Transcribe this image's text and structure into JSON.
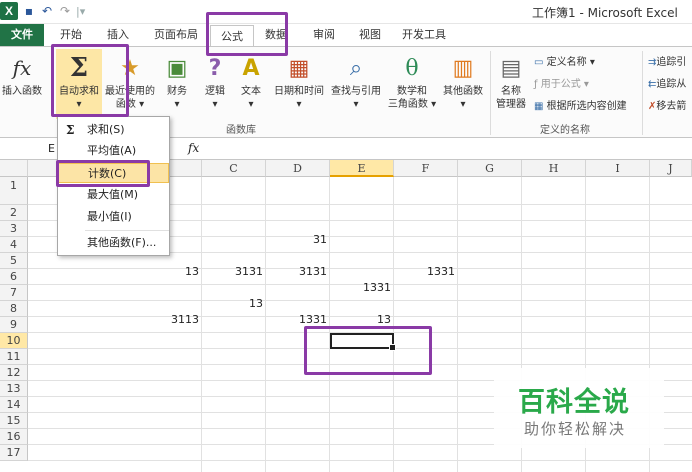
{
  "window": {
    "title": "工作簿1 - Microsoft Excel"
  },
  "tabs": [
    "文件",
    "开始",
    "插入",
    "页面布局",
    "公式",
    "数据",
    "审阅",
    "视图",
    "开发工具"
  ],
  "ribbon": {
    "insert_function": "插入函数",
    "autosum_line1": "自动求和",
    "autosum_arrow": "▾",
    "recent_line1": "最近使用的",
    "recent_line2": "函数 ▾",
    "financial": "财务",
    "logical": "逻辑",
    "text": "文本",
    "datetime": "日期和时间",
    "lookup": "查找与引用",
    "math_line1": "数学和",
    "math_line2": "三角函数 ▾",
    "other_funcs": "其他函数",
    "name_manager_line1": "名称",
    "name_manager_line2": "管理器",
    "define_name": "定义名称 ▾",
    "use_in_formula": "用于公式 ▾",
    "create_from_selection": "根据所选内容创建",
    "trace_precedents": "追踪引",
    "trace_dependents": "追踪从",
    "remove_arrows": "移去箭",
    "group_library": "函数库",
    "group_names": "定义的名称"
  },
  "formula_bar": {
    "name_box": "E",
    "fx": "fx",
    "value": ""
  },
  "menu": {
    "items": [
      {
        "label": "求和(S)"
      },
      {
        "label": "平均值(A)"
      },
      {
        "label": "计数(C)"
      },
      {
        "label": "最大值(M)"
      },
      {
        "label": "最小值(I)"
      },
      {
        "label": "其他函数(F)..."
      }
    ]
  },
  "grid": {
    "columns": [
      "C",
      "D",
      "E",
      "F",
      "G",
      "H",
      "I",
      "J"
    ],
    "rows": [
      "1",
      "2",
      "3",
      "4",
      "5",
      "6",
      "7",
      "8",
      "9",
      "10",
      "11",
      "12",
      "13",
      "14",
      "15",
      "16",
      "17"
    ],
    "cells": {
      "D3": "31",
      "B5": "13",
      "C5": "3131",
      "D5": "3131",
      "F5": "1331",
      "E6": "1331",
      "C7": "13",
      "B8": "3113",
      "D8": "1331",
      "E8": "13"
    },
    "active_cell": "E10"
  },
  "watermark": {
    "title": "百科全说",
    "subtitle": "助你轻松解决"
  },
  "colors": {
    "highlight": "#8a3aa6",
    "file_tab": "#217346",
    "watermark": "#2aa94a"
  }
}
